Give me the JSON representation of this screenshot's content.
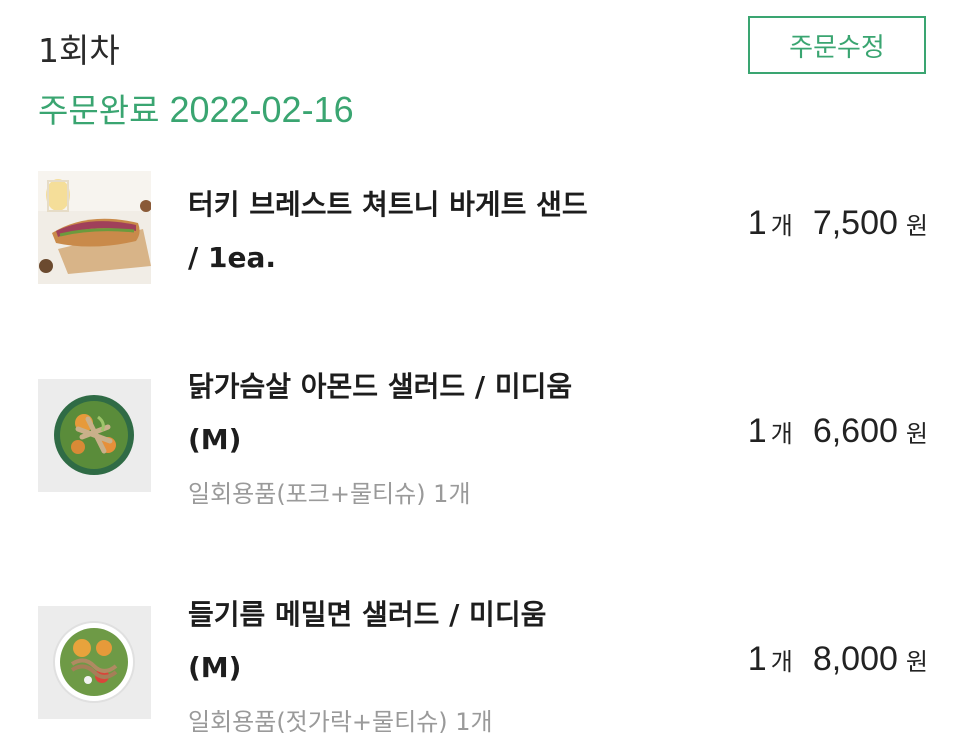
{
  "header": {
    "round": "1회차",
    "status": "주문완료",
    "date": "2022-02-16",
    "edit_button": "주문수정"
  },
  "colors": {
    "accent": "#3aa571",
    "text": "#222222",
    "muted": "#9a9a9a"
  },
  "items": [
    {
      "name": "터키 브레스트 쳐트니 바게트 샌드 / 1ea.",
      "option": "",
      "qty": "1",
      "qty_unit": "개",
      "price": "7,500",
      "currency": "원",
      "image": "baguette-sandwich-photo"
    },
    {
      "name": "닭가슴살 아몬드 샐러드 / 미디움 (M)",
      "option": "일회용품(포크+물티슈) 1개",
      "qty": "1",
      "qty_unit": "개",
      "price": "6,600",
      "currency": "원",
      "image": "chicken-almond-salad-photo"
    },
    {
      "name": "들기름 메밀면 샐러드 / 미디움 (M)",
      "option": "일회용품(젓가락+물티슈) 1개",
      "qty": "1",
      "qty_unit": "개",
      "price": "8,000",
      "currency": "원",
      "image": "buckwheat-noodle-salad-photo"
    }
  ]
}
